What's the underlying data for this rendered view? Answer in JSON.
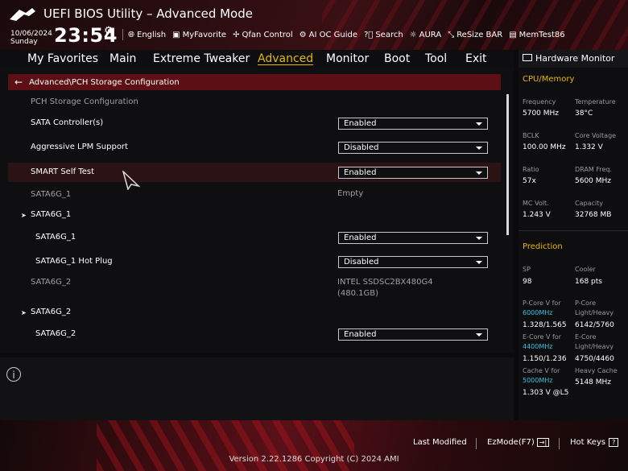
{
  "header": {
    "title": "UEFI BIOS Utility – Advanced Mode",
    "date": "10/06/2024",
    "day": "Sunday",
    "time": "23:54",
    "tools": [
      {
        "icon": "globe-icon",
        "label": "English"
      },
      {
        "icon": "favorite-icon",
        "label": "MyFavorite"
      },
      {
        "icon": "fan-icon",
        "label": "Qfan Control"
      },
      {
        "icon": "ai-oc-icon",
        "label": "AI OC Guide"
      },
      {
        "icon": "search-icon",
        "label": "Search"
      },
      {
        "icon": "aura-icon",
        "label": "AURA"
      },
      {
        "icon": "resize-bar-icon",
        "label": "ReSize BAR"
      },
      {
        "icon": "memtest-icon",
        "label": "MemTest86"
      }
    ]
  },
  "menu": {
    "items": [
      "My Favorites",
      "Main",
      "Extreme Tweaker",
      "Advanced",
      "Monitor",
      "Boot",
      "Tool",
      "Exit"
    ],
    "active": "Advanced"
  },
  "breadcrumb": "Advanced\\PCH Storage Configuration",
  "settings": {
    "section_title": "PCH Storage Configuration",
    "sata_controller": {
      "label": "SATA Controller(s)",
      "value": "Enabled"
    },
    "aggressive_lpm": {
      "label": "Aggressive LPM Support",
      "value": "Disabled"
    },
    "smart_self_test": {
      "label": "SMART Self Test",
      "value": "Enabled"
    },
    "sata6g_1_info": {
      "label": "SATA6G_1",
      "value": "Empty"
    },
    "sata6g_1_group": "SATA6G_1",
    "sata6g_1_port": {
      "label": "SATA6G_1",
      "value": "Enabled"
    },
    "sata6g_1_hotplug": {
      "label": "SATA6G_1 Hot Plug",
      "value": "Disabled"
    },
    "sata6g_2_info": {
      "label": "SATA6G_2",
      "value_line1": "INTEL SSDSC2BX480G4",
      "value_line2": "(480.1GB)"
    },
    "sata6g_2_group": "SATA6G_2",
    "sata6g_2_port": {
      "label": "SATA6G_2",
      "value": "Enabled"
    }
  },
  "hardware_monitor": {
    "title": "Hardware Monitor",
    "cpu_memory": {
      "title": "CPU/Memory",
      "frequency": {
        "label": "Frequency",
        "value": "5700 MHz"
      },
      "temperature": {
        "label": "Temperature",
        "value": "38°C"
      },
      "bclk": {
        "label": "BCLK",
        "value": "100.00 MHz"
      },
      "core_voltage": {
        "label": "Core Voltage",
        "value": "1.332 V"
      },
      "ratio": {
        "label": "Ratio",
        "value": "57x"
      },
      "dram_freq": {
        "label": "DRAM Freq.",
        "value": "5600 MHz"
      },
      "mc_volt": {
        "label": "MC Volt.",
        "value": "1.243 V"
      },
      "capacity": {
        "label": "Capacity",
        "value": "32768 MB"
      }
    },
    "prediction": {
      "title": "Prediction",
      "sp": {
        "label": "SP",
        "value": "98"
      },
      "cooler": {
        "label": "Cooler",
        "value": "168 pts"
      },
      "pcore_v": {
        "label": "P-Core V for",
        "freq": "6000MHz",
        "value": "1.328/1.565"
      },
      "pcore_lh": {
        "label1": "P-Core",
        "label2": "Light/Heavy",
        "value": "6142/5760"
      },
      "ecore_v": {
        "label": "E-Core V for",
        "freq": "4400MHz",
        "value": "1.150/1.236"
      },
      "ecore_lh": {
        "label1": "E-Core",
        "label2": "Light/Heavy",
        "value": "4750/4460"
      },
      "cache_v": {
        "label": "Cache V for",
        "freq": "5000MHz",
        "value": "1.303 V @L5"
      },
      "heavy_cache": {
        "label": "Heavy Cache",
        "value": "5148 MHz"
      }
    }
  },
  "footer": {
    "last_modified": "Last Modified",
    "ezmode": "EzMode(F7)",
    "hot_keys": "Hot Keys",
    "version": "Version 2.22.1286 Copyright (C) 2024 AMI"
  },
  "colors": {
    "accent_yellow": "#e6b800",
    "breadcrumb_red": "#5c0f14",
    "cyan": "#37c3e0"
  }
}
